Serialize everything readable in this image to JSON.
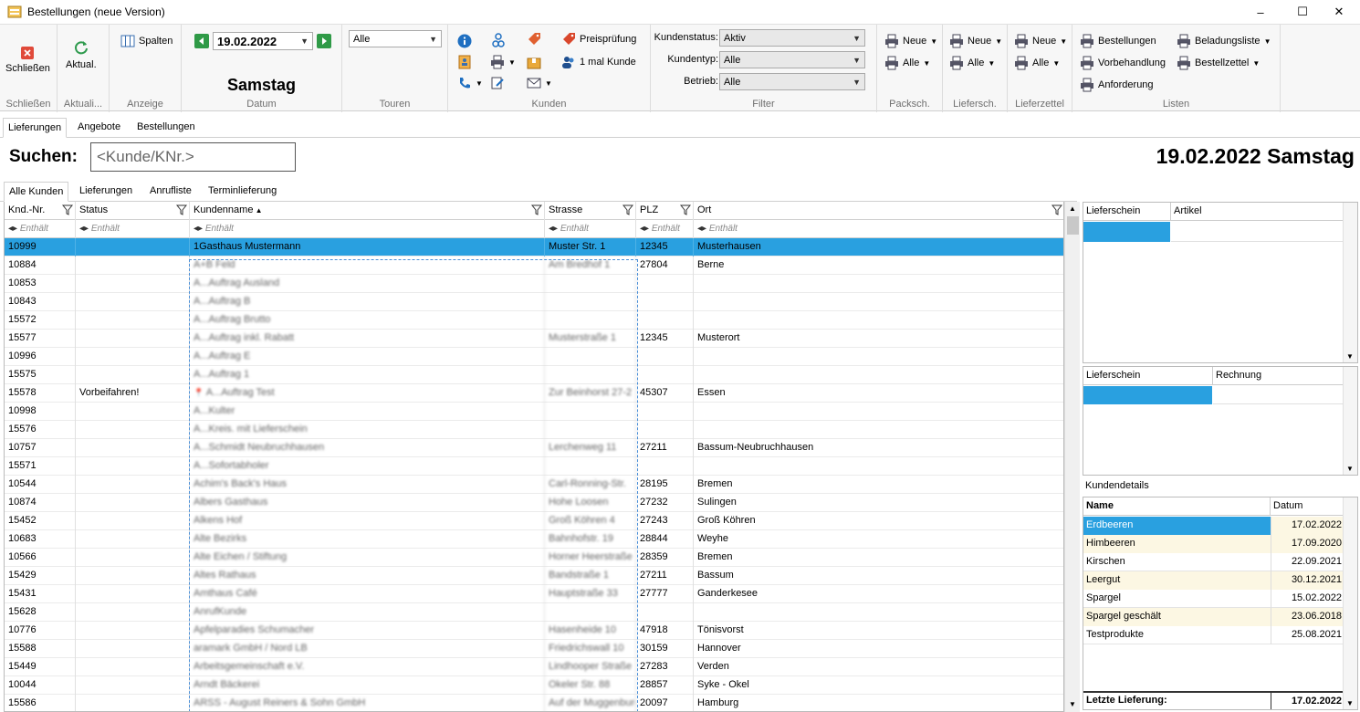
{
  "window": {
    "title": "Bestellungen (neue Version)",
    "controls": [
      "–",
      "☐",
      "✕"
    ]
  },
  "ribbon": {
    "schliessen": {
      "button": "Schließen",
      "group": "Schließen"
    },
    "aktualisieren": {
      "button": "Aktual.",
      "group": "Aktuali..."
    },
    "anzeige": {
      "button": "Spalten",
      "group": "Anzeige"
    },
    "datum": {
      "value": "19.02.2022",
      "weekday": "Samstag",
      "group": "Datum"
    },
    "touren": {
      "value": "Alle",
      "group": "Touren"
    },
    "kunden": {
      "preispruefung": "Preisprüfung",
      "einmal_kunde": "1 mal Kunde",
      "group": "Kunden"
    },
    "filter": {
      "kundenstatus_label": "Kundenstatus:",
      "kundenstatus": "Aktiv",
      "kundentyp_label": "Kundentyp:",
      "kundentyp": "Alle",
      "betrieb_label": "Betrieb:",
      "betrieb": "Alle",
      "group": "Filter"
    },
    "packsch": {
      "neue": "Neue",
      "alle": "Alle",
      "group": "Packsch."
    },
    "liefersch": {
      "neue": "Neue",
      "alle": "Alle",
      "group": "Liefersch."
    },
    "lieferzettel": {
      "neue": "Neue",
      "alle": "Alle",
      "group": "Lieferzettel"
    },
    "listen": {
      "bestellungen": "Bestellungen",
      "vorbehandlung": "Vorbehandlung",
      "anforderung": "Anforderung",
      "beladungsliste": "Beladungsliste",
      "bestellzettel": "Bestellzettel",
      "group": "Listen"
    }
  },
  "main_tabs": [
    "Lieferungen",
    "Angebote",
    "Bestellungen"
  ],
  "search": {
    "label": "Suchen:",
    "placeholder": "<Kunde/KNr.>"
  },
  "date_header": "19.02.2022 Samstag",
  "sub_tabs": [
    "Alle Kunden",
    "Lieferungen",
    "Anrufliste",
    "Terminlieferung"
  ],
  "grid": {
    "columns": [
      "Knd.-Nr.",
      "Status",
      "Kundenname",
      "Strasse",
      "PLZ",
      "Ort"
    ],
    "filter_text": "Enthält",
    "rows": [
      {
        "nr": "10999",
        "status": "",
        "name": "1Gasthaus Mustermann",
        "strasse": "Muster Str. 1",
        "plz": "12345",
        "ort": "Musterhausen"
      },
      {
        "nr": "10884",
        "status": "",
        "name": "A+B Feld",
        "strasse": "Am Bredhof 1",
        "plz": "27804",
        "ort": "Berne"
      },
      {
        "nr": "10853",
        "status": "",
        "name": "A...Auftrag Ausland",
        "strasse": "",
        "plz": "",
        "ort": ""
      },
      {
        "nr": "10843",
        "status": "",
        "name": "A...Auftrag B",
        "strasse": "",
        "plz": "",
        "ort": ""
      },
      {
        "nr": "15572",
        "status": "",
        "name": "A...Auftrag Brutto",
        "strasse": "",
        "plz": "",
        "ort": ""
      },
      {
        "nr": "15577",
        "status": "",
        "name": "A...Auftrag inkl. Rabatt",
        "strasse": "Musterstraße 1",
        "plz": "12345",
        "ort": "Musterort"
      },
      {
        "nr": "10996",
        "status": "",
        "name": "A...Auftrag E",
        "strasse": "",
        "plz": "",
        "ort": ""
      },
      {
        "nr": "15575",
        "status": "",
        "name": "A...Auftrag 1",
        "strasse": "",
        "plz": "",
        "ort": ""
      },
      {
        "nr": "15578",
        "status": "Vorbeifahren!",
        "name": "A...Auftrag Test",
        "strasse": "Zur Beinhorst 27-2",
        "plz": "45307",
        "ort": "Essen"
      },
      {
        "nr": "10998",
        "status": "",
        "name": "A...Kulter",
        "strasse": "",
        "plz": "",
        "ort": ""
      },
      {
        "nr": "15576",
        "status": "",
        "name": "A...Kreis. mit Lieferschein",
        "strasse": "",
        "plz": "",
        "ort": ""
      },
      {
        "nr": "10757",
        "status": "",
        "name": "A...Schmidt Neubruchhausen",
        "strasse": "Lerchenweg 11",
        "plz": "27211",
        "ort": "Bassum-Neubruchhausen"
      },
      {
        "nr": "15571",
        "status": "",
        "name": "A...Sofortabholer",
        "strasse": "",
        "plz": "",
        "ort": ""
      },
      {
        "nr": "10544",
        "status": "",
        "name": "Achim's Back's Haus",
        "strasse": "Carl-Ronning-Str.",
        "plz": "28195",
        "ort": "Bremen"
      },
      {
        "nr": "10874",
        "status": "",
        "name": "Albers Gasthaus",
        "strasse": "Hohe Loosen",
        "plz": "27232",
        "ort": "Sulingen"
      },
      {
        "nr": "15452",
        "status": "",
        "name": "Alkens Hof",
        "strasse": "Groß Köhren 4",
        "plz": "27243",
        "ort": "Groß Köhren"
      },
      {
        "nr": "10683",
        "status": "",
        "name": "Alte Bezirks",
        "strasse": "Bahnhofstr. 19",
        "plz": "28844",
        "ort": "Weyhe"
      },
      {
        "nr": "10566",
        "status": "",
        "name": "Alte Eichen / Stiftung",
        "strasse": "Horner Heerstraße",
        "plz": "28359",
        "ort": "Bremen"
      },
      {
        "nr": "15429",
        "status": "",
        "name": "Altes Rathaus",
        "strasse": "Bandstraße 1",
        "plz": "27211",
        "ort": "Bassum"
      },
      {
        "nr": "15431",
        "status": "",
        "name": "Amthaus Café",
        "strasse": "Hauptstraße 33",
        "plz": "27777",
        "ort": "Ganderkesee"
      },
      {
        "nr": "15628",
        "status": "",
        "name": "AnrufKunde",
        "strasse": "",
        "plz": "",
        "ort": ""
      },
      {
        "nr": "10776",
        "status": "",
        "name": "Apfelparadies Schumacher",
        "strasse": "Hasenheide 10",
        "plz": "47918",
        "ort": "Tönisvorst"
      },
      {
        "nr": "15588",
        "status": "",
        "name": "aramark GmbH / Nord LB",
        "strasse": "Friedrichswall 10",
        "plz": "30159",
        "ort": "Hannover"
      },
      {
        "nr": "15449",
        "status": "",
        "name": "Arbeitsgemeinschaft e.V.",
        "strasse": "Lindhooper Straße",
        "plz": "27283",
        "ort": "Verden"
      },
      {
        "nr": "10044",
        "status": "",
        "name": "Arndt Bäckerei",
        "strasse": "Okeler Str. 88",
        "plz": "28857",
        "ort": "Syke - Okel"
      },
      {
        "nr": "15586",
        "status": "",
        "name": "ARSS - August Reiners & Sohn GmbH",
        "strasse": "Auf der Muggenburg",
        "plz": "20097",
        "ort": "Hamburg"
      }
    ]
  },
  "panel1": {
    "columns": [
      "Lieferschein",
      "Artikel"
    ]
  },
  "panel2": {
    "columns": [
      "Lieferschein",
      "Rechnung"
    ]
  },
  "kundendetails": {
    "title": "Kundendetails",
    "columns": [
      "Name",
      "Datum"
    ],
    "rows": [
      {
        "name": "Erdbeeren",
        "datum": "17.02.2022"
      },
      {
        "name": "Himbeeren",
        "datum": "17.09.2020"
      },
      {
        "name": "Kirschen",
        "datum": "22.09.2021"
      },
      {
        "name": "Leergut",
        "datum": "30.12.2021"
      },
      {
        "name": "Spargel",
        "datum": "15.02.2022"
      },
      {
        "name": "Spargel geschält",
        "datum": "23.06.2018"
      },
      {
        "name": "Testprodukte",
        "datum": "25.08.2021"
      }
    ],
    "footer_label": "Letzte Lieferung:",
    "footer_value": "17.02.2022"
  },
  "colors": {
    "selection": "#29a0e0",
    "detail_alt": "#fcf7e3"
  }
}
